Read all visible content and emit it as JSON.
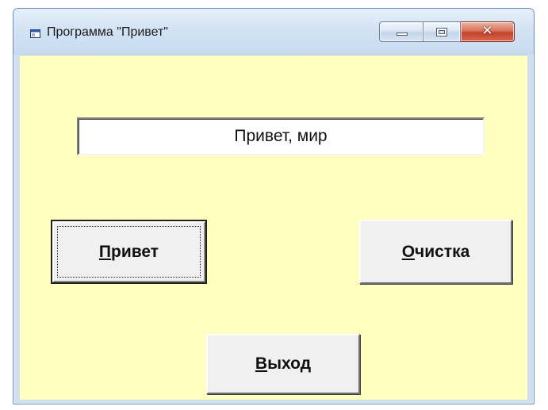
{
  "window": {
    "title": "Программа \"Привет\"",
    "icon": "app-window-icon",
    "controls": {
      "minimize_icon": "minimize-icon",
      "maximize_icon": "maximize-icon",
      "close_icon": "close-icon",
      "close_glyph": "✕"
    }
  },
  "form": {
    "background_color": "#ffffc0",
    "output_text": "Привет, мир",
    "buttons": {
      "hello": {
        "mnemonic": "П",
        "rest": "ривет"
      },
      "clear": {
        "mnemonic": "О",
        "rest": "чистка"
      },
      "exit": {
        "mnemonic": "В",
        "rest": "ыход"
      }
    }
  }
}
